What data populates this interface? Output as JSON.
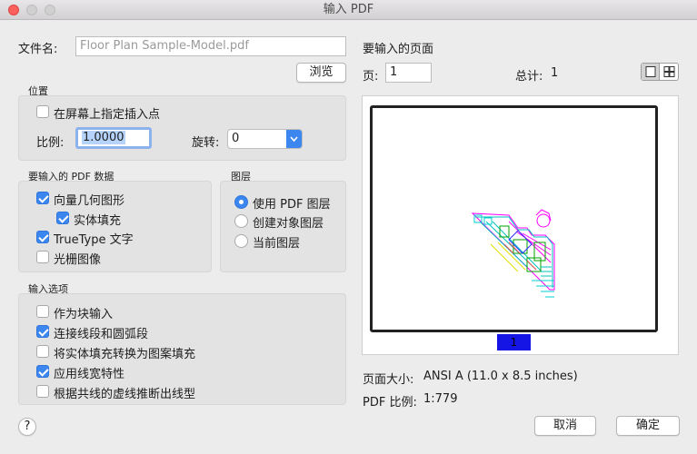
{
  "window": {
    "title": "输入 PDF"
  },
  "file": {
    "label": "文件名:",
    "value": "Floor Plan Sample-Model.pdf",
    "browse_label": "浏览"
  },
  "position": {
    "heading": "位置",
    "specify_on_screen_label": "在屏幕上指定插入点",
    "specify_on_screen_checked": false,
    "scale_label": "比例:",
    "scale_value": "1.0000",
    "rotation_label": "旋转:",
    "rotation_value": "0"
  },
  "pdf_data": {
    "heading": "要输入的 PDF 数据",
    "items": [
      {
        "label": "向量几何图形",
        "checked": true
      },
      {
        "label": "实体填充",
        "checked": true
      },
      {
        "label": "TrueType 文字",
        "checked": true
      },
      {
        "label": "光栅图像",
        "checked": false
      }
    ]
  },
  "layers": {
    "heading": "图层",
    "options": [
      {
        "label": "使用 PDF 图层",
        "selected": true
      },
      {
        "label": "创建对象图层",
        "selected": false
      },
      {
        "label": "当前图层",
        "selected": false
      }
    ]
  },
  "import_options": {
    "heading": "输入选项",
    "items": [
      {
        "label": "作为块输入",
        "checked": false
      },
      {
        "label": "连接线段和圆弧段",
        "checked": true
      },
      {
        "label": "将实体填充转换为图案填充",
        "checked": false
      },
      {
        "label": "应用线宽特性",
        "checked": true
      },
      {
        "label": "根据共线的虚线推断出线型",
        "checked": false
      }
    ]
  },
  "pages": {
    "heading": "要输入的页面",
    "page_label": "页:",
    "page_value": "1",
    "total_label": "总计:",
    "total_value": "1",
    "thumbnail_badge": "1",
    "page_size_label": "页面大小:",
    "page_size_value": "ANSI A (11.0 x 8.5 inches)",
    "pdf_scale_label": "PDF 比例:",
    "pdf_scale_value": "1:779"
  },
  "footer": {
    "help_label": "?",
    "cancel_label": "取消",
    "ok_label": "确定"
  },
  "colors": {
    "accent": "#3c86f0",
    "badge": "#1515e6"
  }
}
